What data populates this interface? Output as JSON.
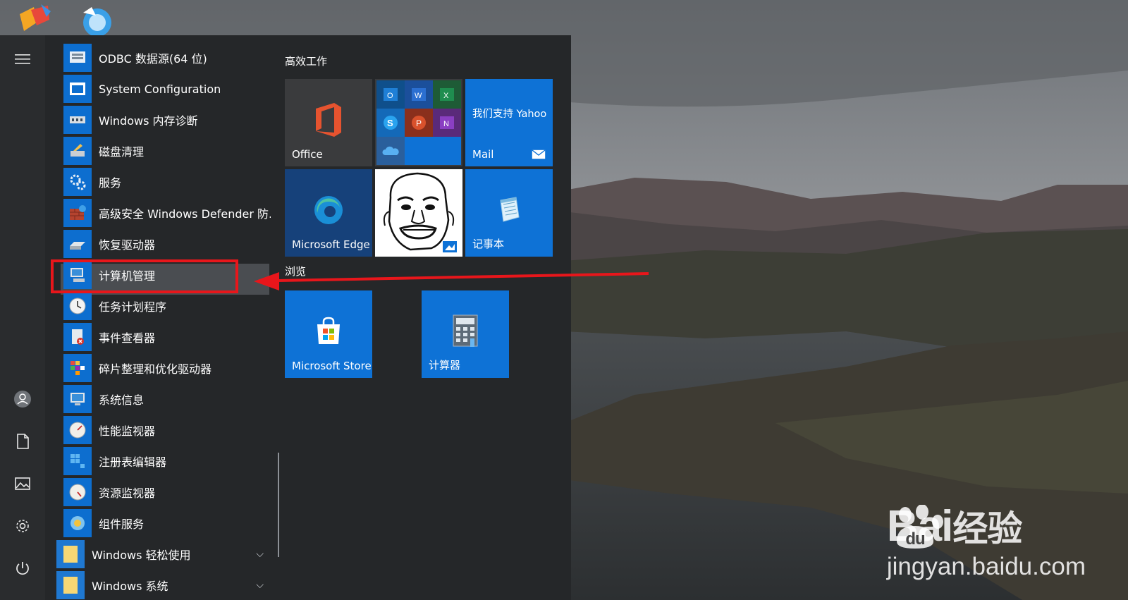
{
  "desktop": {
    "icons": [
      "app-icon",
      "browser-icon"
    ],
    "watermark": {
      "logo_left": "Bai",
      "logo_right": "经验",
      "url": "jingyan.baidu.com"
    }
  },
  "rail": {
    "menu_icon": "hamburger-icon",
    "bottom_icons": [
      "user-icon",
      "document-icon",
      "pictures-icon",
      "settings-icon",
      "power-icon"
    ]
  },
  "apps": [
    {
      "label": "ODBC 数据源(64 位)",
      "icon": "odbc-icon"
    },
    {
      "label": "System Configuration",
      "icon": "system-config-icon"
    },
    {
      "label": "Windows 内存诊断",
      "icon": "memory-diagnostic-icon"
    },
    {
      "label": "磁盘清理",
      "icon": "disk-cleanup-icon"
    },
    {
      "label": "服务",
      "icon": "services-icon"
    },
    {
      "label": "高级安全 Windows Defender 防...",
      "icon": "firewall-icon"
    },
    {
      "label": "恢复驱动器",
      "icon": "recovery-drive-icon"
    },
    {
      "label": "计算机管理",
      "icon": "computer-management-icon"
    },
    {
      "label": "任务计划程序",
      "icon": "task-scheduler-icon"
    },
    {
      "label": "事件查看器",
      "icon": "event-viewer-icon"
    },
    {
      "label": "碎片整理和优化驱动器",
      "icon": "defrag-icon"
    },
    {
      "label": "系统信息",
      "icon": "system-info-icon"
    },
    {
      "label": "性能监视器",
      "icon": "performance-monitor-icon"
    },
    {
      "label": "注册表编辑器",
      "icon": "registry-editor-icon"
    },
    {
      "label": "资源监视器",
      "icon": "resource-monitor-icon"
    },
    {
      "label": "组件服务",
      "icon": "component-services-icon"
    }
  ],
  "folders": [
    {
      "label": "Windows 轻松使用",
      "icon": "folder-icon"
    },
    {
      "label": "Windows 系统",
      "icon": "folder-icon"
    }
  ],
  "tiles": {
    "group1": "高效工作",
    "group2": "浏览",
    "office": "Office",
    "mail_top": "我们支持 Yahoo",
    "mail": "Mail",
    "edge": "Microsoft Edge",
    "notepad": "记事本",
    "store": "Microsoft Store",
    "calculator": "计算器"
  },
  "colors": {
    "accent": "#0e72d6",
    "highlight": "#e8161b",
    "menu_bg": "#252729"
  }
}
